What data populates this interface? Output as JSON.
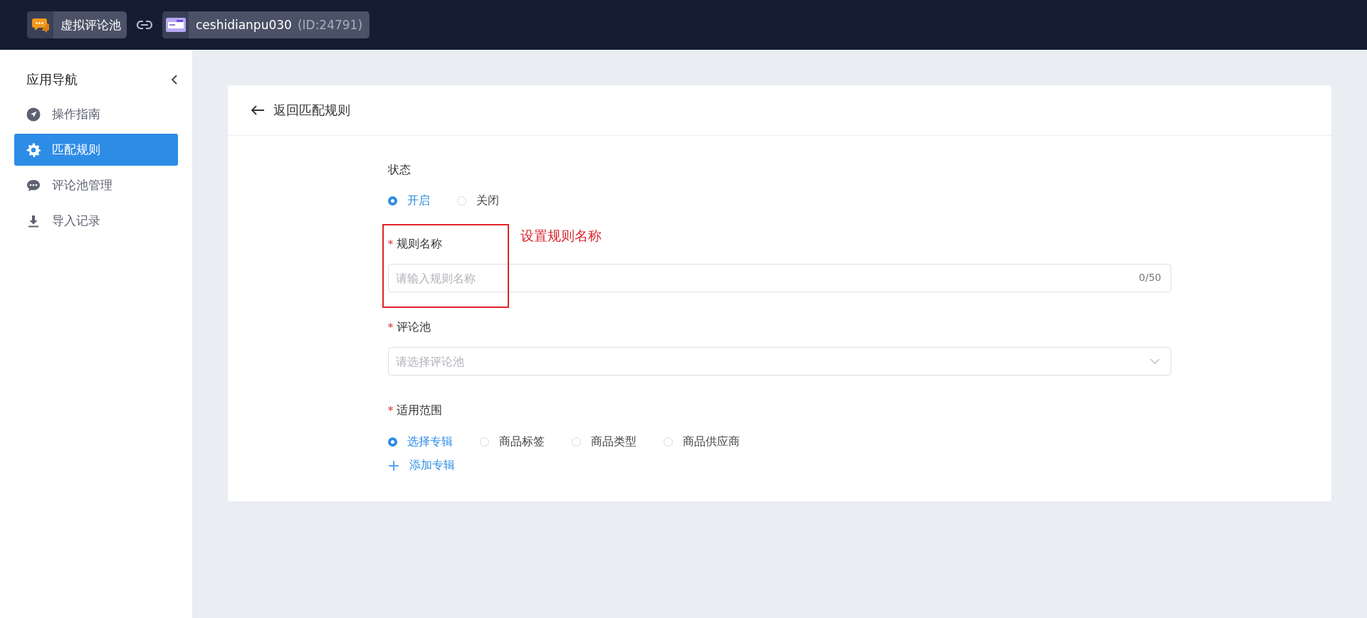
{
  "top_bar": {
    "app": {
      "name": "虚拟评论池"
    },
    "shop": {
      "name": "ceshidianpu030",
      "id": "(ID:24791)"
    }
  },
  "sidebar": {
    "title": "应用导航",
    "items": [
      {
        "label": "操作指南",
        "selected": false
      },
      {
        "label": "匹配规则",
        "selected": true
      },
      {
        "label": "评论池管理",
        "selected": false
      },
      {
        "label": "导入记录",
        "selected": false
      }
    ]
  },
  "page": {
    "back": "返回匹配规则",
    "status": {
      "label": "状态",
      "options": [
        {
          "label": "开启",
          "selected": true
        },
        {
          "label": "关闭",
          "selected": false
        }
      ]
    },
    "rule_name": {
      "label": "规则名称",
      "required": true,
      "placeholder": "请输入规则名称",
      "counter": "0/50"
    },
    "comment_pool": {
      "label": "评论池",
      "required": true,
      "placeholder": "请选择评论池"
    },
    "scope": {
      "label": "适用范围",
      "required": true,
      "options": [
        {
          "label": "选择专辑",
          "selected": true
        },
        {
          "label": "商品标签",
          "selected": false
        },
        {
          "label": "商品类型",
          "selected": false
        },
        {
          "label": "商品供应商",
          "selected": false
        }
      ],
      "add": "添加专辑"
    },
    "annotation": "设置规则名称"
  }
}
